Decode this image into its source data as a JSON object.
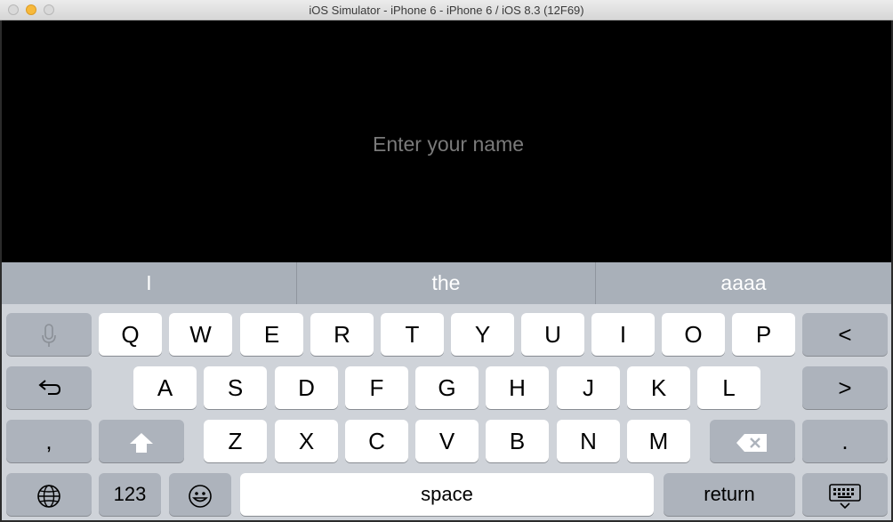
{
  "window": {
    "title": "iOS Simulator - iPhone 6 - iPhone 6 / iOS 8.3 (12F69)"
  },
  "screen": {
    "name_field": {
      "placeholder": "Enter your name",
      "value": ""
    }
  },
  "keyboard": {
    "suggestions": [
      "I",
      "the",
      "aaaa"
    ],
    "row1": [
      "Q",
      "W",
      "E",
      "R",
      "T",
      "Y",
      "U",
      "I",
      "O",
      "P"
    ],
    "row2": [
      "A",
      "S",
      "D",
      "F",
      "G",
      "H",
      "J",
      "K",
      "L"
    ],
    "row3": [
      "Z",
      "X",
      "C",
      "V",
      "B",
      "N",
      "M"
    ],
    "comma_label": ",",
    "period_label": ".",
    "numbers_label": "123",
    "space_label": "space",
    "return_label": "return",
    "left_arrow": "<",
    "right_arrow": ">",
    "icons": {
      "mic": "microphone-icon",
      "undo": "undo-icon",
      "shift": "shift-icon",
      "delete": "delete-icon",
      "globe": "globe-icon",
      "emoji": "emoji-icon",
      "dismiss": "keyboard-dismiss-icon"
    }
  }
}
